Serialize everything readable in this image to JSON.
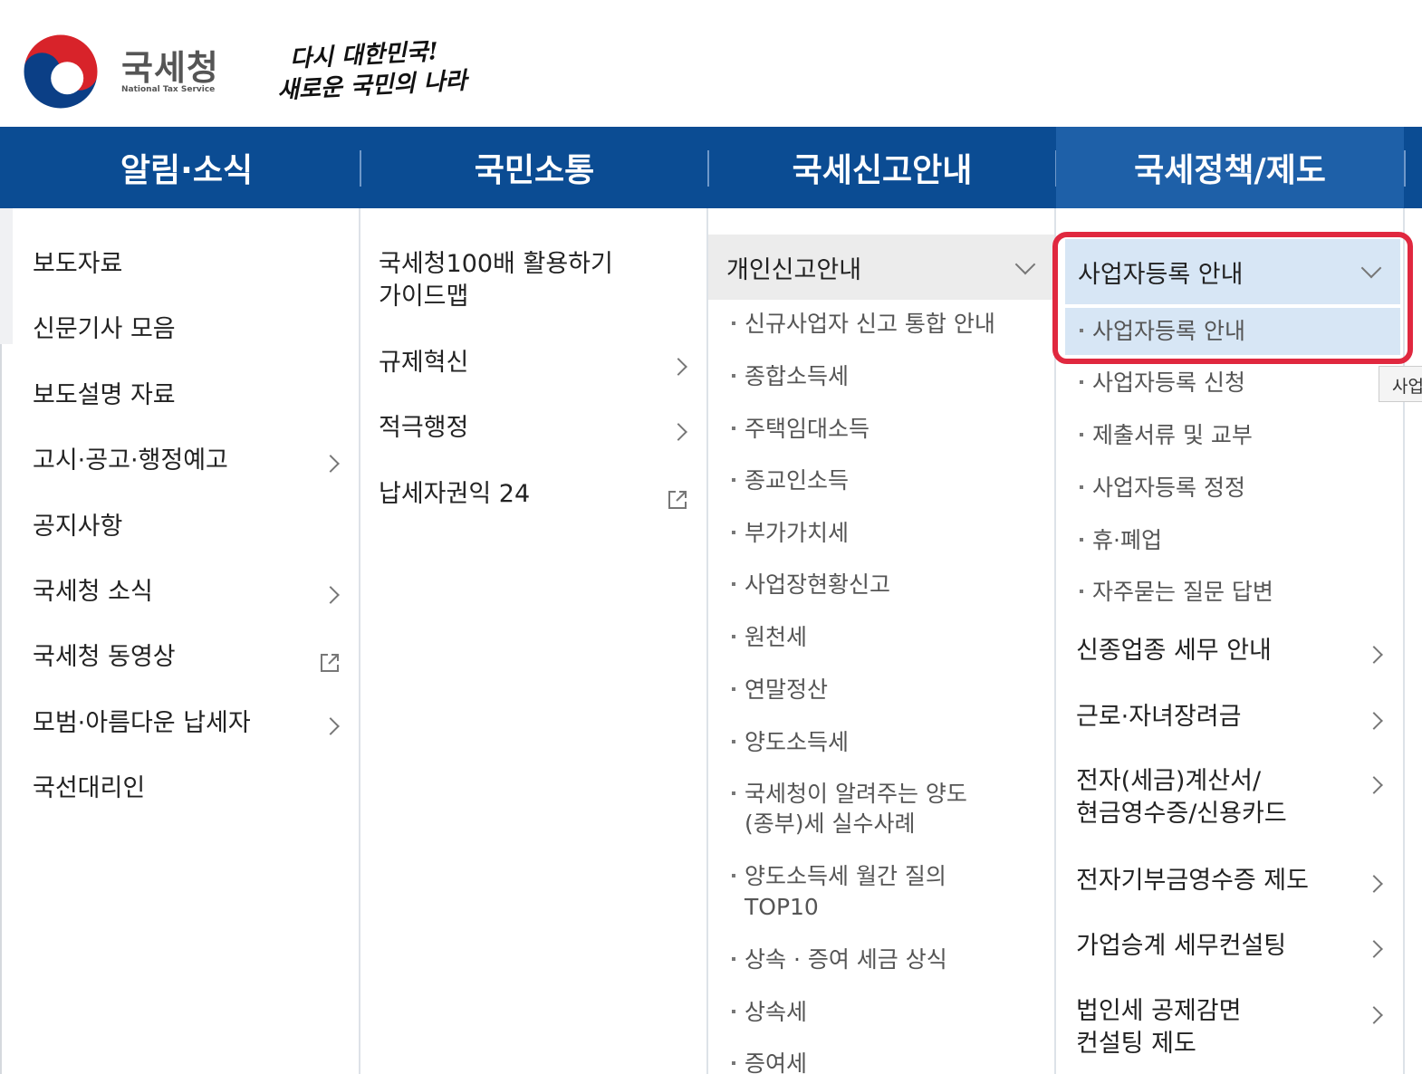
{
  "header": {
    "logo_ko": "국세청",
    "logo_en": "National Tax Service",
    "slogan_line1": "다시 대한민국!",
    "slogan_line2": "새로운 국민의 나라"
  },
  "nav": {
    "tabs": [
      "알림·소식",
      "국민소통",
      "국세신고안내",
      "국세정책/제도"
    ],
    "active_index": 3
  },
  "col1": {
    "items": [
      "보도자료",
      "신문기사 모음",
      "보도설명 자료",
      "고시·공고·행정예고",
      "공지사항",
      "국세청 소식",
      "국세청 동영상",
      "모범·아름다운 납세자",
      "국선대리인"
    ]
  },
  "col2": {
    "items": [
      "국세청100배 활용하기",
      "가이드맵",
      "규제혁신",
      "적극행정",
      "납세자권익 24"
    ]
  },
  "col3": {
    "group_title": "개인신고안내",
    "subs": [
      "신규사업자 신고 통합 안내",
      "종합소득세",
      "주택임대소득",
      "종교인소득",
      "부가가치세",
      "사업장현황신고",
      "원천세",
      "연말정산",
      "양도소득세",
      "국세청이 알려주는 양도",
      "(종부)세 실수사례",
      "양도소득세 월간 질의",
      "TOP10",
      "상속 · 증여 세금 상식",
      "상속세",
      "증여세"
    ]
  },
  "col4": {
    "group_title": "사업자등록 안내",
    "subs": [
      "사업자등록 안내",
      "사업자등록 신청",
      "제출서류 및 교부",
      "사업자등록 정정",
      "휴·폐업",
      "자주묻는 질문 답변"
    ],
    "items": [
      "신종업종 세무 안내",
      "근로·자녀장려금",
      "전자(세금)계산서/",
      "현금영수증/신용카드",
      "전자기부금영수증 제도",
      "가업승계 세무컨설팅",
      "법인세 공제감면",
      "컨설팅 제도"
    ]
  },
  "tooltip": "사업",
  "colors": {
    "nav_bg": "#0b4c93",
    "nav_active": "#1e60a8",
    "highlight": "#e0283f",
    "selected_bg": "#d7e6f5"
  }
}
